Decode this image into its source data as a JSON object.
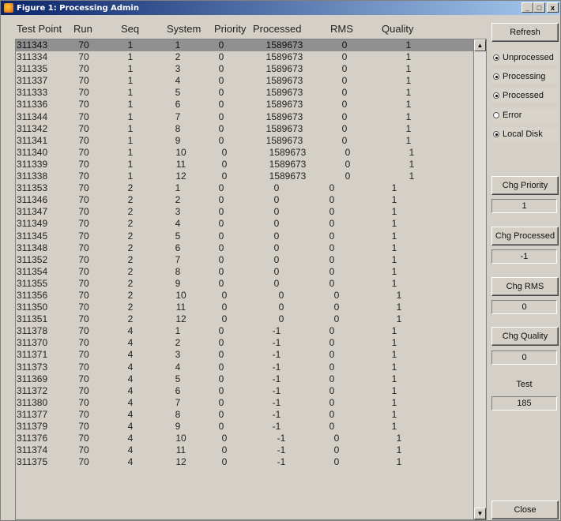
{
  "window": {
    "title": "Figure 1: Processing Admin",
    "buttons": [
      "_",
      "□",
      "x"
    ]
  },
  "table": {
    "headers": [
      "Test Point",
      "Run",
      "Seq",
      "System",
      "Priority",
      "Processed",
      "RMS",
      "Quality"
    ],
    "rows": [
      [
        "311343",
        "70",
        "1",
        "1",
        "0",
        "1589673",
        "0",
        "1"
      ],
      [
        "311334",
        "70",
        "1",
        "2",
        "0",
        "1589673",
        "0",
        "1"
      ],
      [
        "311335",
        "70",
        "1",
        "3",
        "0",
        "1589673",
        "0",
        "1"
      ],
      [
        "311337",
        "70",
        "1",
        "4",
        "0",
        "1589673",
        "0",
        "1"
      ],
      [
        "311333",
        "70",
        "1",
        "5",
        "0",
        "1589673",
        "0",
        "1"
      ],
      [
        "311336",
        "70",
        "1",
        "6",
        "0",
        "1589673",
        "0",
        "1"
      ],
      [
        "311344",
        "70",
        "1",
        "7",
        "0",
        "1589673",
        "0",
        "1"
      ],
      [
        "311342",
        "70",
        "1",
        "8",
        "0",
        "1589673",
        "0",
        "1"
      ],
      [
        "311341",
        "70",
        "1",
        "9",
        "0",
        "1589673",
        "0",
        "1"
      ],
      [
        "311340",
        "70",
        "1",
        "10",
        "0",
        "1589673",
        "0",
        "1"
      ],
      [
        "311339",
        "70",
        "1",
        "11",
        "0",
        "1589673",
        "0",
        "1"
      ],
      [
        "311338",
        "70",
        "1",
        "12",
        "0",
        "1589673",
        "0",
        "1"
      ],
      [
        "311353",
        "70",
        "2",
        "1",
        "0",
        "0",
        "0",
        "1"
      ],
      [
        "311346",
        "70",
        "2",
        "2",
        "0",
        "0",
        "0",
        "1"
      ],
      [
        "311347",
        "70",
        "2",
        "3",
        "0",
        "0",
        "0",
        "1"
      ],
      [
        "311349",
        "70",
        "2",
        "4",
        "0",
        "0",
        "0",
        "1"
      ],
      [
        "311345",
        "70",
        "2",
        "5",
        "0",
        "0",
        "0",
        "1"
      ],
      [
        "311348",
        "70",
        "2",
        "6",
        "0",
        "0",
        "0",
        "1"
      ],
      [
        "311352",
        "70",
        "2",
        "7",
        "0",
        "0",
        "0",
        "1"
      ],
      [
        "311354",
        "70",
        "2",
        "8",
        "0",
        "0",
        "0",
        "1"
      ],
      [
        "311355",
        "70",
        "2",
        "9",
        "0",
        "0",
        "0",
        "1"
      ],
      [
        "311356",
        "70",
        "2",
        "10",
        "0",
        "0",
        "0",
        "1"
      ],
      [
        "311350",
        "70",
        "2",
        "11",
        "0",
        "0",
        "0",
        "1"
      ],
      [
        "311351",
        "70",
        "2",
        "12",
        "0",
        "0",
        "0",
        "1"
      ],
      [
        "311378",
        "70",
        "4",
        "1",
        "0",
        "-1",
        "0",
        "1"
      ],
      [
        "311370",
        "70",
        "4",
        "2",
        "0",
        "-1",
        "0",
        "1"
      ],
      [
        "311371",
        "70",
        "4",
        "3",
        "0",
        "-1",
        "0",
        "1"
      ],
      [
        "311373",
        "70",
        "4",
        "4",
        "0",
        "-1",
        "0",
        "1"
      ],
      [
        "311369",
        "70",
        "4",
        "5",
        "0",
        "-1",
        "0",
        "1"
      ],
      [
        "311372",
        "70",
        "4",
        "6",
        "0",
        "-1",
        "0",
        "1"
      ],
      [
        "311380",
        "70",
        "4",
        "7",
        "0",
        "-1",
        "0",
        "1"
      ],
      [
        "311377",
        "70",
        "4",
        "8",
        "0",
        "-1",
        "0",
        "1"
      ],
      [
        "311379",
        "70",
        "4",
        "9",
        "0",
        "-1",
        "0",
        "1"
      ],
      [
        "311376",
        "70",
        "4",
        "10",
        "0",
        "-1",
        "0",
        "1"
      ],
      [
        "311374",
        "70",
        "4",
        "11",
        "0",
        "-1",
        "0",
        "1"
      ],
      [
        "311375",
        "70",
        "4",
        "12",
        "0",
        "-1",
        "0",
        "1"
      ]
    ],
    "selected_row": 0
  },
  "sidebar": {
    "refresh_label": "Refresh",
    "radios": [
      {
        "label": "Unprocessed",
        "checked": true
      },
      {
        "label": "Processing",
        "checked": true
      },
      {
        "label": "Processed",
        "checked": true
      },
      {
        "label": "Error",
        "checked": false
      },
      {
        "label": "Local Disk",
        "checked": true
      }
    ],
    "chg_priority_label": "Chg Priority",
    "priority_value": "1",
    "chg_processed_label": "Chg Processed",
    "processed_value": "-1",
    "chg_rms_label": "Chg RMS",
    "rms_value": "0",
    "chg_quality_label": "Chg Quality",
    "quality_value": "0",
    "test_label": "Test",
    "test_value": "185",
    "close_label": "Close"
  },
  "scrollbar": {
    "up_glyph": "▲",
    "down_glyph": "▼"
  }
}
